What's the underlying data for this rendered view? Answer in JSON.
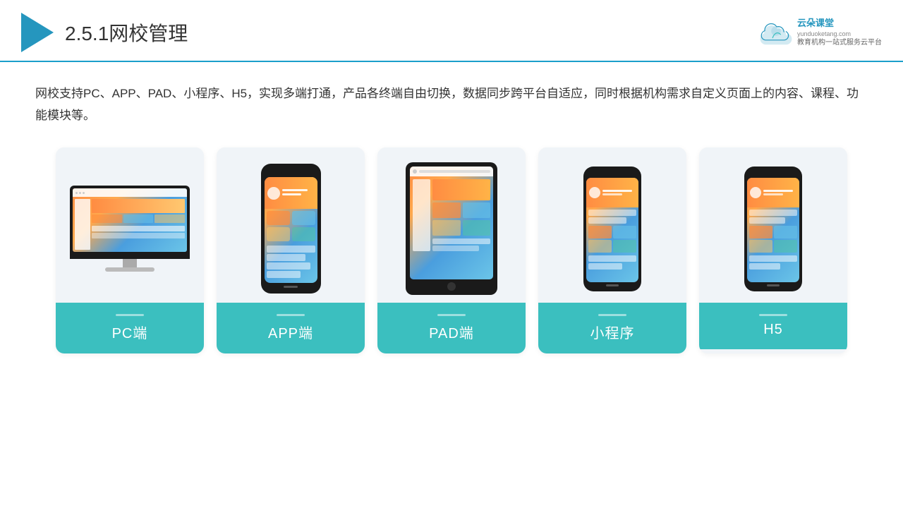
{
  "header": {
    "title": "2.5.1网校管理",
    "title_num": "2.5.1",
    "title_text": "网校管理",
    "logo_brand": "云朵课堂",
    "logo_url": "yunduoketang.com",
    "logo_slogan_line1": "教育机构一站",
    "logo_slogan_line2": "式服务云平台"
  },
  "description": {
    "text": "网校支持PC、APP、PAD、小程序、H5，实现多端打通，产品各终端自由切换，数据同步跨平台自适应，同时根据机构需求自定义页面上的内容、课程、功能模块等。"
  },
  "cards": [
    {
      "id": "pc",
      "label": "PC端"
    },
    {
      "id": "app",
      "label": "APP端"
    },
    {
      "id": "pad",
      "label": "PAD端"
    },
    {
      "id": "miniprogram",
      "label": "小程序"
    },
    {
      "id": "h5",
      "label": "H5"
    }
  ],
  "colors": {
    "accent": "#3bbfbf",
    "header_line": "#1a9fcb",
    "logo_color": "#2596be",
    "card_bg": "#f0f4f8"
  }
}
